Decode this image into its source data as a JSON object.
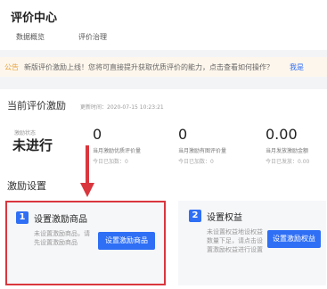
{
  "header": {
    "title": "评价中心",
    "tabs": [
      "数据概览",
      "评价治理"
    ]
  },
  "notice": {
    "tag": "公告",
    "text": "新版评价激励上线！您将可直接提升获取优质评价的能力，点击查看如何操作？",
    "link": "我是"
  },
  "incentive": {
    "title": "当前评价激励",
    "update_time": "更新时间：2020-07-15 10:23:21",
    "status_label": "激励状态",
    "status_value": "未进行",
    "stats": [
      {
        "value": "0",
        "label": "当月激励优质评价量",
        "sub": "今日已加数：0"
      },
      {
        "value": "0",
        "label": "当月激励有图评价量",
        "sub": "今日已加数：0"
      },
      {
        "value": "0.00",
        "label": "当月发放激励金额",
        "sub": "今日已发放：0.00"
      }
    ]
  },
  "settings": {
    "title": "激励设置",
    "cards": [
      {
        "badge": "1",
        "title": "设置激励商品",
        "desc": "未设置激励商品，请先设置激励商品",
        "button": "设置激励商品"
      },
      {
        "badge": "2",
        "title": "设置权益",
        "desc": "未设置权益地设权益数量下足，请点击设置激励权益进行设置",
        "button": "设置激励权益"
      }
    ]
  },
  "colors": {
    "accent": "#2f6ff5",
    "highlight": "#d9363e",
    "notice_bg": "#fdf6ec",
    "notice_tag": "#e6a23c"
  }
}
